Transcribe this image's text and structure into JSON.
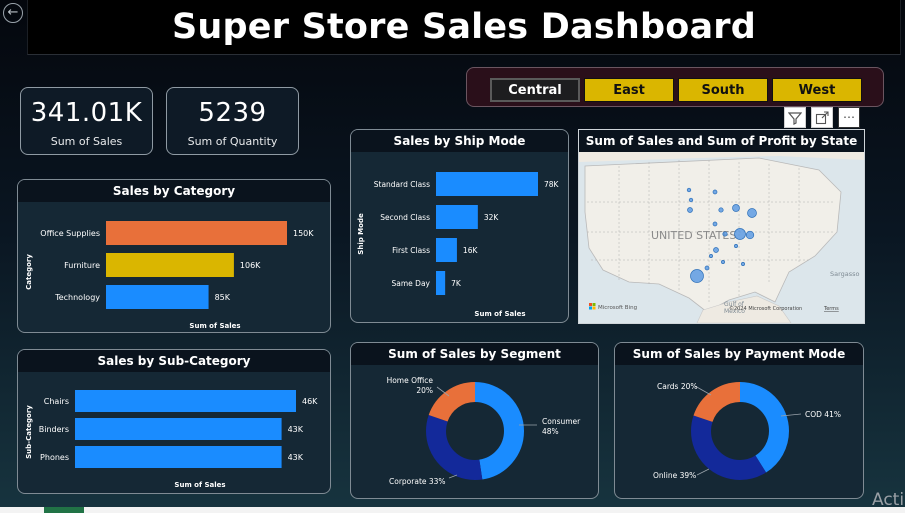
{
  "header": {
    "title": "Super Store Sales Dashboard",
    "back_icon": "arrow-left-icon"
  },
  "slicer": {
    "items": [
      {
        "label": "Central",
        "selected": true
      },
      {
        "label": "East",
        "selected": false
      },
      {
        "label": "South",
        "selected": false
      },
      {
        "label": "West",
        "selected": false
      }
    ],
    "colors": {
      "selected": "#1d1d1f",
      "option": "#dab600"
    }
  },
  "visual_toolbar": {
    "icons": [
      "filter-icon",
      "focus-mode-icon",
      "more-options-icon"
    ]
  },
  "kpis": [
    {
      "value": "341.01K",
      "label": "Sum of Sales"
    },
    {
      "value": "5239",
      "label": "Sum of Quantity"
    }
  ],
  "map": {
    "title": "Sum of Sales and Sum of Profit by State",
    "label_country": "UNITED STATES",
    "label_gulf": "Gulf of",
    "label_mexico": "Mexico",
    "label_sargasso": "Sargasso",
    "attribution": "©2024 Microsoft Corporation",
    "terms": "Terms",
    "bing": "Microsoft Bing",
    "bubble_color": "#4a90e2"
  },
  "chart_data": [
    {
      "type": "bar",
      "orientation": "horizontal",
      "title": "Sales by Category",
      "ylabel": "Category",
      "xlabel": "Sum of Sales",
      "categories": [
        "Office Supplies",
        "Furniture",
        "Technology"
      ],
      "values": [
        150000,
        106000,
        85000
      ],
      "labels": [
        "150K",
        "106K",
        "85K"
      ],
      "colors": [
        "#e8703a",
        "#dab600",
        "#1a8cff"
      ],
      "xlim": [
        0,
        150000
      ]
    },
    {
      "type": "bar",
      "orientation": "horizontal",
      "title": "Sales by Sub-Category",
      "ylabel": "Sub-Category",
      "xlabel": "Sum of Sales",
      "categories": [
        "Chairs",
        "Binders",
        "Phones"
      ],
      "values": [
        46000,
        43000,
        43000
      ],
      "labels": [
        "46K",
        "43K",
        "43K"
      ],
      "colors": [
        "#1a8cff",
        "#1a8cff",
        "#1a8cff"
      ],
      "xlim": [
        0,
        46000
      ]
    },
    {
      "type": "bar",
      "orientation": "horizontal",
      "title": "Sales by Ship Mode",
      "ylabel": "Ship Mode",
      "xlabel": "Sum of Sales",
      "categories": [
        "Standard Class",
        "Second Class",
        "First Class",
        "Same Day"
      ],
      "values": [
        78000,
        32000,
        16000,
        7000
      ],
      "labels": [
        "78K",
        "32K",
        "16K",
        "7K"
      ],
      "colors": [
        "#1a8cff",
        "#1a8cff",
        "#1a8cff",
        "#1a8cff"
      ],
      "xlim": [
        0,
        78000
      ]
    },
    {
      "type": "pie",
      "donut": true,
      "title": "Sum of Sales by Segment",
      "categories": [
        "Consumer",
        "Corporate",
        "Home Office"
      ],
      "values": [
        48,
        33,
        20
      ],
      "labels": [
        "Consumer 48%",
        "Corporate 33%",
        "Home Office 20%"
      ],
      "colors": [
        "#1a8cff",
        "#13299a",
        "#e8703a"
      ]
    },
    {
      "type": "pie",
      "donut": true,
      "title": "Sum of Sales by Payment Mode",
      "categories": [
        "COD",
        "Online",
        "Cards"
      ],
      "values": [
        41,
        39,
        20
      ],
      "labels": [
        "COD 41%",
        "Online 39%",
        "Cards 20%"
      ],
      "colors": [
        "#1a8cff",
        "#13299a",
        "#e8703a"
      ]
    }
  ],
  "watermark": "Acti"
}
